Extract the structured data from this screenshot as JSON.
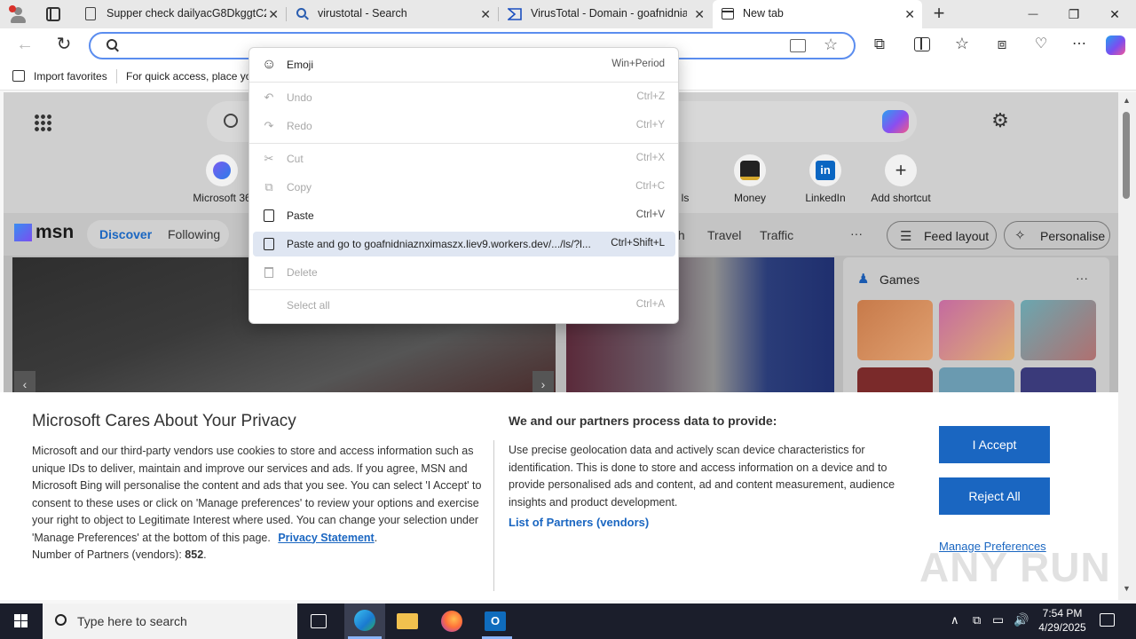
{
  "tabs": [
    {
      "title": "Supper check dailyacG8DkggtC2(",
      "close": "✕"
    },
    {
      "title": "virustotal - Search",
      "close": "✕"
    },
    {
      "title": "VirusTotal - Domain - goafnidnia",
      "close": "✕"
    },
    {
      "title": "New tab",
      "close": "✕"
    }
  ],
  "new_tab_glyph": "+",
  "window_controls": {
    "minimize": "—",
    "maximize": "❐",
    "close": "✕"
  },
  "address_bar": {
    "value": ""
  },
  "favorites_bar": {
    "import_label": "Import favorites",
    "hint": "For quick access, place yo"
  },
  "newtab": {
    "shortcuts": [
      {
        "label": "Microsoft 36"
      },
      {
        "label": "ls"
      },
      {
        "label": "Money"
      },
      {
        "label": "LinkedIn"
      },
      {
        "label": "Add shortcut",
        "glyph": "+"
      }
    ],
    "msn_logo": "msn",
    "feed_tabs": [
      "Discover",
      "Following"
    ],
    "feed_tabs_right": [
      "th",
      "Travel",
      "Traffic"
    ],
    "more_glyph": "···",
    "feed_layout": "Feed layout",
    "personalise": "Personalise",
    "games_title": "Games",
    "games_more": "···"
  },
  "context_menu": {
    "items": [
      {
        "label": "Emoji",
        "shortcut": "Win+Period",
        "icon": "emoji-icon",
        "glyph": "☺",
        "disabled": false
      },
      {
        "label": "Undo",
        "shortcut": "Ctrl+Z",
        "icon": "undo-icon",
        "glyph": "↶",
        "disabled": true
      },
      {
        "label": "Redo",
        "shortcut": "Ctrl+Y",
        "icon": "redo-icon",
        "glyph": "↷",
        "disabled": true
      },
      {
        "label": "Cut",
        "shortcut": "Ctrl+X",
        "icon": "cut-icon",
        "glyph": "✂",
        "disabled": true
      },
      {
        "label": "Copy",
        "shortcut": "Ctrl+C",
        "icon": "copy-icon",
        "glyph": "⧉",
        "disabled": true
      },
      {
        "label": "Paste",
        "shortcut": "Ctrl+V",
        "icon": "paste-icon",
        "glyph": "📋",
        "disabled": false
      },
      {
        "label": "Paste and go to goafnidniaznximaszx.liev9.workers.dev/.../ls/?l...",
        "shortcut": "Ctrl+Shift+L",
        "icon": "paste-go-icon",
        "glyph": "⎘",
        "disabled": false,
        "highlighted": true
      },
      {
        "label": "Delete",
        "shortcut": "",
        "icon": "delete-icon",
        "glyph": "🗑",
        "disabled": true
      },
      {
        "label": "Select all",
        "shortcut": "Ctrl+A",
        "icon": "",
        "glyph": "",
        "disabled": true
      }
    ]
  },
  "privacy": {
    "title": "Microsoft Cares About Your Privacy",
    "body": "Microsoft and our third-party vendors use cookies to store and access information such as unique IDs to deliver, maintain and improve our services and ads. If you agree, MSN and Microsoft Bing will personalise the content and ads that you see. You can select 'I Accept' to consent to these uses or click on 'Manage preferences' to review your options and exercise your right to object to Legitimate Interest where used.  You can change your selection under 'Manage Preferences' at the bottom of this page.",
    "privacy_link": "Privacy Statement",
    "partners_label": "Number of Partners (vendors):",
    "partners_count": "852",
    "right_title": "We and our partners process data to provide:",
    "right_body": "Use precise geolocation data and actively scan device characteristics for identification. This is done to store and access information on a device and to provide personalised ads and content, ad and content measurement, audience insights and product development.",
    "vendors_link": "List of Partners (vendors)",
    "accept": "I Accept",
    "reject": "Reject All",
    "manage": "Manage Preferences"
  },
  "watermark": "ANY RUN",
  "taskbar": {
    "search_placeholder": "Type here to search",
    "time": "7:54 PM",
    "date": "4/29/2025"
  },
  "colors": {
    "accent": "#1a66c1",
    "address_border": "#5b8def",
    "taskbar": "#1b1e2b"
  }
}
